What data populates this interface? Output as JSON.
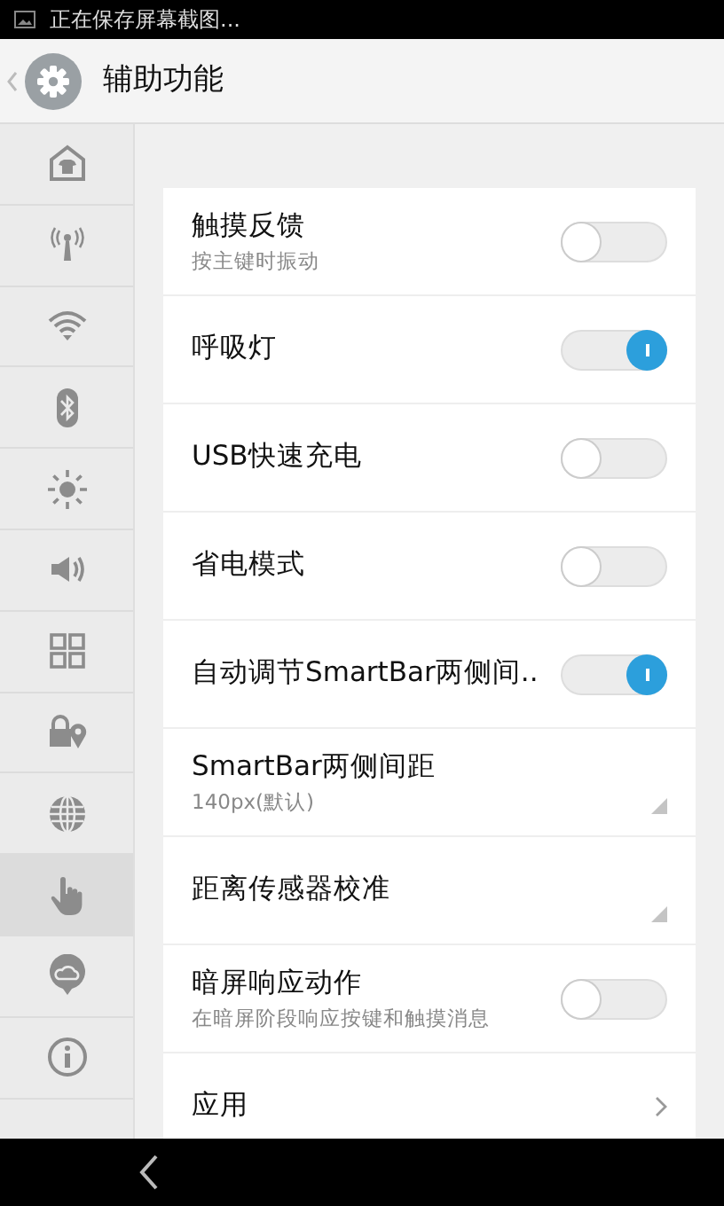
{
  "status_bar": {
    "notification": "正在保存屏幕截图..."
  },
  "header": {
    "title": "辅助功能"
  },
  "sidebar": {
    "items": [
      {
        "selected": false
      },
      {
        "selected": false
      },
      {
        "selected": false
      },
      {
        "selected": false
      },
      {
        "selected": false
      },
      {
        "selected": false
      },
      {
        "selected": false
      },
      {
        "selected": false
      },
      {
        "selected": false
      },
      {
        "selected": true
      },
      {
        "selected": false
      },
      {
        "selected": false
      }
    ]
  },
  "settings": [
    {
      "kind": "toggle",
      "title": "触摸反馈",
      "subtitle": "按主键时振动",
      "on": false
    },
    {
      "kind": "toggle",
      "title": "呼吸灯",
      "on": true
    },
    {
      "kind": "toggle",
      "title": "USB快速充电",
      "on": false
    },
    {
      "kind": "toggle",
      "title": "省电模式",
      "on": false
    },
    {
      "kind": "toggle",
      "title": "自动调节SmartBar两侧间..",
      "on": true
    },
    {
      "kind": "dropdown",
      "title": "SmartBar两侧间距",
      "subtitle": "140px(默认)"
    },
    {
      "kind": "dropdown",
      "title": "距离传感器校准"
    },
    {
      "kind": "toggle",
      "title": "暗屏响应动作",
      "subtitle": "在暗屏阶段响应按键和触摸消息",
      "on": false
    },
    {
      "kind": "link",
      "title": "应用"
    }
  ]
}
